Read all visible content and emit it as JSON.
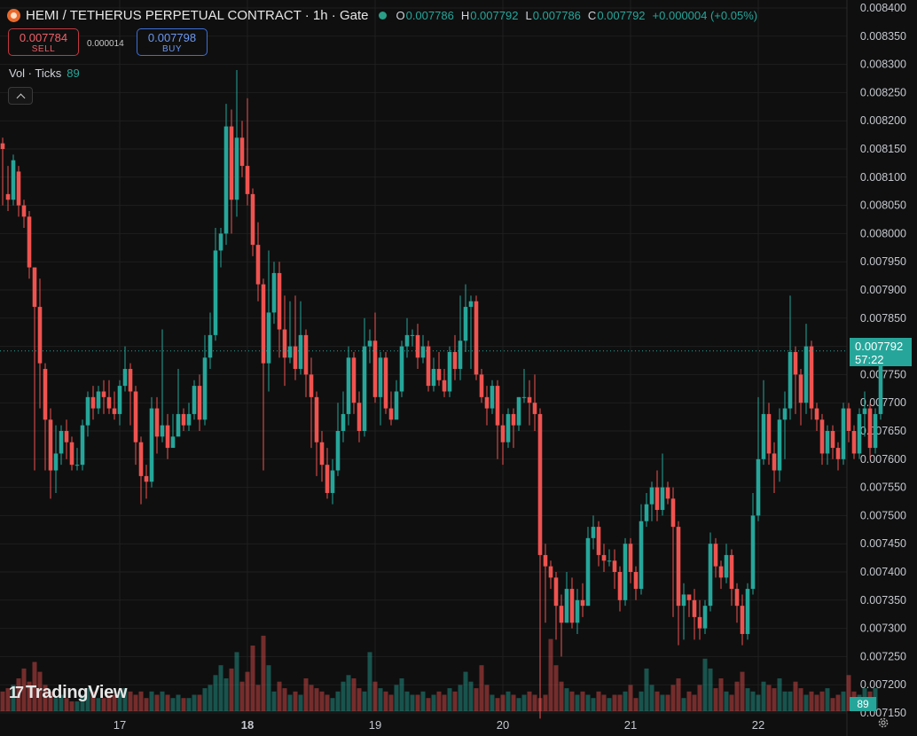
{
  "header": {
    "symbol": "HEMI / TETHERUS PERPETUAL CONTRACT · 1h · Gate",
    "open_label": "O",
    "open": "0.007786",
    "high_label": "H",
    "high": "0.007792",
    "low_label": "L",
    "low": "0.007786",
    "close_label": "C",
    "close": "0.007792",
    "change": "+0.000004 (+0.05%)"
  },
  "trade": {
    "sell_price": "0.007784",
    "sell_label": "SELL",
    "spread": "0.000014",
    "buy_price": "0.007798",
    "buy_label": "BUY"
  },
  "volume": {
    "label": "Vol · Ticks",
    "value": "89"
  },
  "branding": "TradingView",
  "price_tag": {
    "price": "0.007792",
    "countdown": "57:22"
  },
  "volume_tag": "89",
  "colors": {
    "up": "#26a69a",
    "down": "#ef5350",
    "background": "#0f0f0f",
    "grid": "#1f1f1f"
  },
  "icons": [
    "collapse-chevron-icon",
    "settings-gear-icon",
    "tradingview-logo-icon"
  ],
  "chart_data": {
    "type": "candlestick",
    "y_ticks": [
      "0.008400",
      "0.008350",
      "0.008300",
      "0.008250",
      "0.008200",
      "0.008150",
      "0.008100",
      "0.008050",
      "0.008000",
      "0.007950",
      "0.007900",
      "0.007850",
      "0.007800",
      "0.007750",
      "0.007700",
      "0.007650",
      "0.007600",
      "0.007550",
      "0.007500",
      "0.007450",
      "0.007400",
      "0.007350",
      "0.007300",
      "0.007250",
      "0.007200",
      "0.007150"
    ],
    "ylim": [
      0.00713,
      0.008405
    ],
    "x_labels": [
      "17",
      "18",
      "19",
      "20",
      "21",
      "22"
    ],
    "x_label_candle_index": [
      22,
      46,
      70,
      94,
      118,
      142
    ],
    "grid": true,
    "candles": [
      [
        0.00816,
        0.00815,
        0.00817,
        0.00805
      ],
      [
        0.00807,
        0.00806,
        0.00812,
        0.00804
      ],
      [
        0.00806,
        0.00813,
        0.00814,
        0.00805
      ],
      [
        0.00811,
        0.00805,
        0.00812,
        0.00803
      ],
      [
        0.00805,
        0.00803,
        0.00806,
        0.00801
      ],
      [
        0.00803,
        0.00794,
        0.00804,
        0.00792
      ],
      [
        0.00794,
        0.00787,
        0.00794,
        0.00758
      ],
      [
        0.00787,
        0.00777,
        0.00792,
        0.00769
      ],
      [
        0.00776,
        0.00767,
        0.00777,
        0.00758
      ],
      [
        0.00767,
        0.00758,
        0.00769,
        0.00753
      ],
      [
        0.00758,
        0.00761,
        0.00766,
        0.00754
      ],
      [
        0.00761,
        0.00765,
        0.00766,
        0.00759
      ],
      [
        0.00765,
        0.00763,
        0.00767,
        0.0076
      ],
      [
        0.00763,
        0.00759,
        0.00764,
        0.00758
      ],
      [
        0.00759,
        0.00759,
        0.00762,
        0.00758
      ],
      [
        0.00759,
        0.00766,
        0.00767,
        0.00758
      ],
      [
        0.00766,
        0.00771,
        0.00772,
        0.00764
      ],
      [
        0.00771,
        0.00769,
        0.00773,
        0.00767
      ],
      [
        0.00769,
        0.00772,
        0.00773,
        0.00768
      ],
      [
        0.00772,
        0.00771,
        0.00774,
        0.00768
      ],
      [
        0.00771,
        0.00769,
        0.00774,
        0.00768
      ],
      [
        0.00769,
        0.00768,
        0.00772,
        0.00767
      ],
      [
        0.00768,
        0.00773,
        0.00774,
        0.00766
      ],
      [
        0.00773,
        0.00776,
        0.0078,
        0.00772
      ],
      [
        0.00776,
        0.00772,
        0.00777,
        0.00766
      ],
      [
        0.00772,
        0.00763,
        0.00773,
        0.00759
      ],
      [
        0.00763,
        0.00757,
        0.00764,
        0.00752
      ],
      [
        0.00757,
        0.00756,
        0.00759,
        0.00753
      ],
      [
        0.00756,
        0.00769,
        0.00771,
        0.00755
      ],
      [
        0.00769,
        0.00764,
        0.00771,
        0.00761
      ],
      [
        0.00764,
        0.00766,
        0.00783,
        0.00763
      ],
      [
        0.00766,
        0.00762,
        0.00768,
        0.0076
      ],
      [
        0.00762,
        0.00764,
        0.00768,
        0.00763
      ],
      [
        0.00764,
        0.00768,
        0.00776,
        0.00767
      ],
      [
        0.00768,
        0.00766,
        0.00769,
        0.00765
      ],
      [
        0.00766,
        0.00768,
        0.0077,
        0.00765
      ],
      [
        0.00768,
        0.00773,
        0.00774,
        0.00767
      ],
      [
        0.00773,
        0.00767,
        0.00775,
        0.00765
      ],
      [
        0.00767,
        0.00778,
        0.00782,
        0.00766
      ],
      [
        0.00778,
        0.00782,
        0.00786,
        0.00776
      ],
      [
        0.00782,
        0.00797,
        0.00801,
        0.00781
      ],
      [
        0.00797,
        0.008,
        0.00801,
        0.00794
      ],
      [
        0.008,
        0.00819,
        0.00823,
        0.00798
      ],
      [
        0.00819,
        0.00806,
        0.00822,
        0.008
      ],
      [
        0.00806,
        0.00817,
        0.00829,
        0.00803
      ],
      [
        0.00817,
        0.00812,
        0.0082,
        0.0081
      ],
      [
        0.00812,
        0.00807,
        0.00824,
        0.00805
      ],
      [
        0.00807,
        0.00798,
        0.00808,
        0.00796
      ],
      [
        0.00798,
        0.00791,
        0.00802,
        0.00788
      ],
      [
        0.00791,
        0.00777,
        0.00792,
        0.00758
      ],
      [
        0.00777,
        0.00786,
        0.00797,
        0.00772
      ],
      [
        0.00786,
        0.00793,
        0.00795,
        0.00784
      ],
      [
        0.00793,
        0.00783,
        0.00795,
        0.00778
      ],
      [
        0.00783,
        0.00778,
        0.00789,
        0.00773
      ],
      [
        0.00778,
        0.0078,
        0.00788,
        0.00777
      ],
      [
        0.0078,
        0.00776,
        0.00789,
        0.00774
      ],
      [
        0.00776,
        0.00782,
        0.00788,
        0.00775
      ],
      [
        0.00782,
        0.00775,
        0.00783,
        0.00771
      ],
      [
        0.00775,
        0.00771,
        0.00778,
        0.00762
      ],
      [
        0.00771,
        0.00763,
        0.00772,
        0.00757
      ],
      [
        0.00763,
        0.00759,
        0.00765,
        0.00756
      ],
      [
        0.00759,
        0.00754,
        0.00762,
        0.00753
      ],
      [
        0.00754,
        0.00758,
        0.0076,
        0.00752
      ],
      [
        0.00758,
        0.00765,
        0.0077,
        0.00757
      ],
      [
        0.00765,
        0.00768,
        0.00772,
        0.00763
      ],
      [
        0.00768,
        0.00778,
        0.0078,
        0.00766
      ],
      [
        0.00778,
        0.0077,
        0.00779,
        0.00768
      ],
      [
        0.0077,
        0.00765,
        0.00772,
        0.00763
      ],
      [
        0.00765,
        0.0078,
        0.00785,
        0.00764
      ],
      [
        0.0078,
        0.00781,
        0.00783,
        0.00777
      ],
      [
        0.00781,
        0.00771,
        0.00786,
        0.0077
      ],
      [
        0.00771,
        0.00778,
        0.00779,
        0.00766
      ],
      [
        0.00778,
        0.00769,
        0.00779,
        0.00768
      ],
      [
        0.00769,
        0.00767,
        0.00772,
        0.00766
      ],
      [
        0.00767,
        0.00772,
        0.00774,
        0.0077
      ],
      [
        0.00772,
        0.0078,
        0.00781,
        0.00771
      ],
      [
        0.0078,
        0.00782,
        0.00785,
        0.00778
      ],
      [
        0.00782,
        0.00782,
        0.00783,
        0.0078
      ],
      [
        0.00782,
        0.00778,
        0.00784,
        0.00776
      ],
      [
        0.00778,
        0.0078,
        0.00782,
        0.00777
      ],
      [
        0.0078,
        0.00773,
        0.00781,
        0.00772
      ],
      [
        0.00773,
        0.00776,
        0.00778,
        0.00772
      ],
      [
        0.00776,
        0.00774,
        0.00779,
        0.00773
      ],
      [
        0.00774,
        0.00772,
        0.00776,
        0.00771
      ],
      [
        0.00772,
        0.00779,
        0.0078,
        0.00771
      ],
      [
        0.00779,
        0.00776,
        0.00782,
        0.00774
      ],
      [
        0.00776,
        0.00781,
        0.00789,
        0.00774
      ],
      [
        0.00781,
        0.00787,
        0.00791,
        0.00779
      ],
      [
        0.00787,
        0.00788,
        0.00789,
        0.00776
      ],
      [
        0.00788,
        0.00775,
        0.00789,
        0.00774
      ],
      [
        0.00775,
        0.00771,
        0.00776,
        0.0077
      ],
      [
        0.00771,
        0.00769,
        0.00773,
        0.00766
      ],
      [
        0.00769,
        0.00773,
        0.00774,
        0.00768
      ],
      [
        0.00773,
        0.00766,
        0.00774,
        0.0076
      ],
      [
        0.00766,
        0.00763,
        0.00768,
        0.00759
      ],
      [
        0.00763,
        0.00768,
        0.00769,
        0.00762
      ],
      [
        0.00768,
        0.00766,
        0.00769,
        0.00762
      ],
      [
        0.00766,
        0.00771,
        0.00771,
        0.00765
      ],
      [
        0.00771,
        0.00771,
        0.00776,
        0.0077
      ],
      [
        0.00771,
        0.0077,
        0.00774,
        0.00766
      ],
      [
        0.0077,
        0.00768,
        0.00775,
        0.00765
      ],
      [
        0.00768,
        0.00743,
        0.00769,
        0.00714
      ],
      [
        0.00743,
        0.00741,
        0.00745,
        0.00731
      ],
      [
        0.00741,
        0.00739,
        0.00742,
        0.00737
      ],
      [
        0.00739,
        0.00734,
        0.0074,
        0.00728
      ],
      [
        0.00734,
        0.00731,
        0.00736,
        0.00725
      ],
      [
        0.00731,
        0.00737,
        0.0074,
        0.00731
      ],
      [
        0.00737,
        0.00731,
        0.00739,
        0.0073
      ],
      [
        0.00731,
        0.00735,
        0.00737,
        0.00729
      ],
      [
        0.00735,
        0.00734,
        0.00738,
        0.00732
      ],
      [
        0.00734,
        0.00746,
        0.00748,
        0.00734
      ],
      [
        0.00746,
        0.00748,
        0.0075,
        0.00744
      ],
      [
        0.00748,
        0.00743,
        0.00749,
        0.00741
      ],
      [
        0.00743,
        0.00742,
        0.00745,
        0.0074
      ],
      [
        0.00742,
        0.00742,
        0.00744,
        0.00741
      ],
      [
        0.00742,
        0.0074,
        0.00744,
        0.00737
      ],
      [
        0.0074,
        0.00735,
        0.00741,
        0.00733
      ],
      [
        0.00735,
        0.00745,
        0.00746,
        0.00734
      ],
      [
        0.00745,
        0.0074,
        0.00746,
        0.00738
      ],
      [
        0.0074,
        0.00737,
        0.00741,
        0.00735
      ],
      [
        0.00737,
        0.00749,
        0.00752,
        0.00736
      ],
      [
        0.00749,
        0.00752,
        0.00754,
        0.00748
      ],
      [
        0.00752,
        0.00755,
        0.00756,
        0.00749
      ],
      [
        0.00755,
        0.00751,
        0.00758,
        0.00749
      ],
      [
        0.00751,
        0.00755,
        0.00761,
        0.0075
      ],
      [
        0.00755,
        0.00753,
        0.00756,
        0.00752
      ],
      [
        0.00753,
        0.00748,
        0.00755,
        0.00732
      ],
      [
        0.00748,
        0.00734,
        0.00749,
        0.00727
      ],
      [
        0.00734,
        0.00736,
        0.00738,
        0.00728
      ],
      [
        0.00736,
        0.00735,
        0.00736,
        0.00732
      ],
      [
        0.00735,
        0.00732,
        0.00737,
        0.00728
      ],
      [
        0.00732,
        0.0073,
        0.00735,
        0.00728
      ],
      [
        0.0073,
        0.00734,
        0.00735,
        0.00729
      ],
      [
        0.00734,
        0.00745,
        0.00747,
        0.00733
      ],
      [
        0.00745,
        0.00741,
        0.00746,
        0.00739
      ],
      [
        0.00741,
        0.00739,
        0.00742,
        0.00737
      ],
      [
        0.00739,
        0.00743,
        0.00745,
        0.00738
      ],
      [
        0.00743,
        0.00737,
        0.00744,
        0.00734
      ],
      [
        0.00737,
        0.00734,
        0.00738,
        0.00731
      ],
      [
        0.00734,
        0.00729,
        0.00736,
        0.00727
      ],
      [
        0.00729,
        0.00737,
        0.00738,
        0.00728
      ],
      [
        0.00737,
        0.0075,
        0.00754,
        0.00736
      ],
      [
        0.0075,
        0.0076,
        0.00771,
        0.00749
      ],
      [
        0.0076,
        0.00768,
        0.00774,
        0.00759
      ],
      [
        0.00768,
        0.00761,
        0.0077,
        0.00759
      ],
      [
        0.00761,
        0.00758,
        0.00763,
        0.00754
      ],
      [
        0.00758,
        0.00767,
        0.00769,
        0.00756
      ],
      [
        0.00767,
        0.00769,
        0.00772,
        0.0076
      ],
      [
        0.00769,
        0.00779,
        0.00789,
        0.00767
      ],
      [
        0.00779,
        0.00775,
        0.0078,
        0.00768
      ],
      [
        0.00775,
        0.0077,
        0.00776,
        0.00766
      ],
      [
        0.0077,
        0.0078,
        0.00784,
        0.00768
      ],
      [
        0.0078,
        0.00769,
        0.00781,
        0.00767
      ],
      [
        0.00769,
        0.00767,
        0.0077,
        0.00765
      ],
      [
        0.00767,
        0.00761,
        0.00768,
        0.00759
      ],
      [
        0.00761,
        0.00765,
        0.00766,
        0.00759
      ],
      [
        0.00765,
        0.00762,
        0.00766,
        0.0076
      ],
      [
        0.00762,
        0.0076,
        0.00763,
        0.00758
      ],
      [
        0.0076,
        0.00769,
        0.0077,
        0.00759
      ],
      [
        0.00769,
        0.00765,
        0.0077,
        0.00763
      ],
      [
        0.00765,
        0.00761,
        0.00766,
        0.0076
      ],
      [
        0.00761,
        0.00768,
        0.00769,
        0.0076
      ],
      [
        0.00768,
        0.00769,
        0.00772,
        0.00764
      ],
      [
        0.00769,
        0.00762,
        0.0077,
        0.0076
      ],
      [
        0.00762,
        0.00768,
        0.00769,
        0.00761
      ],
      [
        0.00768,
        0.00779,
        0.0078,
        0.00767
      ],
      [
        0.00779,
        0.00779,
        0.0078,
        0.00778
      ]
    ],
    "volumes": [
      6,
      7,
      8,
      10,
      13,
      9,
      15,
      12,
      8,
      6,
      4,
      5,
      4,
      3,
      3,
      5,
      7,
      6,
      4,
      4,
      5,
      5,
      6,
      7,
      6,
      5,
      6,
      4,
      6,
      5,
      6,
      5,
      4,
      5,
      4,
      4,
      5,
      5,
      7,
      8,
      11,
      14,
      10,
      13,
      18,
      9,
      12,
      20,
      8,
      23,
      14,
      6,
      9,
      7,
      5,
      6,
      5,
      10,
      8,
      7,
      6,
      5,
      4,
      6,
      9,
      11,
      10,
      7,
      6,
      18,
      9,
      7,
      6,
      5,
      8,
      10,
      6,
      5,
      5,
      6,
      4,
      5,
      6,
      5,
      7,
      6,
      8,
      12,
      9,
      7,
      14,
      8,
      5,
      4,
      5,
      6,
      5,
      4,
      5,
      6,
      5,
      4,
      5,
      22,
      14,
      9,
      7,
      6,
      5,
      6,
      5,
      4,
      6,
      5,
      4,
      5,
      5,
      6,
      8,
      4,
      6,
      13,
      8,
      6,
      5,
      5,
      8,
      10,
      4,
      6,
      5,
      8,
      16,
      13,
      7,
      10,
      6,
      5,
      9,
      12,
      7,
      6,
      5,
      9,
      8,
      7,
      10,
      6,
      6,
      9,
      7,
      5,
      6,
      5,
      6,
      7,
      4,
      5,
      6,
      11,
      6,
      5,
      7,
      6,
      7
    ]
  }
}
